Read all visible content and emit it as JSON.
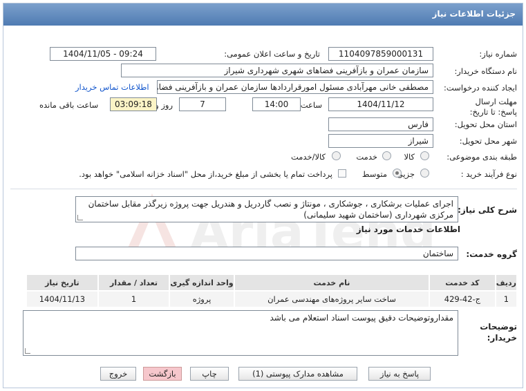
{
  "header": {
    "title": "جزئیات اطلاعات نیاز"
  },
  "fields": {
    "need_number_label": "شماره نیاز:",
    "need_number": "1104097859000131",
    "announce_label": "تاریخ و ساعت اعلان عمومی:",
    "announce_value": "1404/11/05 - 09:24",
    "buyer_org_label": "نام دستگاه خریدار:",
    "buyer_org": "سازمان عمران و بازآفرینی فضاهای شهری شهرداری شیراز",
    "creator_label": "ایجاد کننده درخواست:",
    "creator": "مصطفی خانی مهرآبادی مسئول امورقراردادها سازمان عمران و بازآفرینی فضاهای",
    "contact_link": "اطلاعات تماس خریدار",
    "deadline_label": "مهلت ارسال پاسخ: تا تاریخ:",
    "deadline_date": "1404/11/12",
    "time_label": "ساعت",
    "deadline_time": "14:00",
    "days_value": "7",
    "days_label": "روز و",
    "remaining_time": "03:09:18",
    "remaining_label": "ساعت باقی مانده",
    "province_label": "استان محل تحویل:",
    "province": "فارس",
    "city_label": "شهر محل تحویل:",
    "city": "شیراز",
    "category_label": "طبقه بندی موضوعی:",
    "category_options": [
      "کالا",
      "خدمت",
      "کالا/خدمت"
    ],
    "process_label": "نوع فرآیند خرید :",
    "process_options": [
      "جزیی",
      "متوسط"
    ],
    "payment_note": "پرداخت تمام یا بخشی از مبلغ خرید،از محل \"اسناد خزانه اسلامی\" خواهد بود."
  },
  "description": {
    "label": "شرح کلی نیاز:",
    "text": "اجرای عملیات برشکاری ، جوشکاری ، مونتاژ و نصب گاردریل و هندریل جهت پروژه زیرگذر مقابل ساختمان مرکزی شهرداری (ساختمان شهید سلیمانی)"
  },
  "services": {
    "section_title": "اطلاعات خدمات مورد نیاز",
    "group_label": "گروه خدمت:",
    "group_value": "ساختمان",
    "columns": [
      "ردیف",
      "کد خدمت",
      "نام خدمت",
      "واحد اندازه گیری",
      "تعداد / مقدار",
      "تاریخ نیاز"
    ],
    "rows": [
      [
        "1",
        "ج-42-429",
        "ساخت سایر پروژه‌های مهندسی عمران",
        "پروژه",
        "1",
        "1404/11/13"
      ]
    ]
  },
  "notes": {
    "label": "توضیحات خریدار:",
    "text": "مقداروتوضیحات دقیق پیوست اسناد استعلام می باشد"
  },
  "buttons": {
    "reply": "پاسخ به نیاز",
    "attachments": "مشاهده مدارک پیوستی (1)",
    "print": "چاپ",
    "back": "بازگشت",
    "exit": "خروج"
  },
  "watermark_text": "AriaTender.net"
}
